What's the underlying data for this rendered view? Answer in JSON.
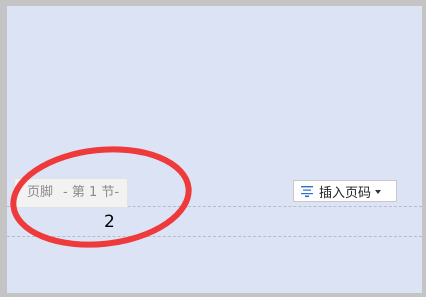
{
  "footer": {
    "label": "页脚",
    "section": "- 第 1 节-",
    "page_number": "2"
  },
  "insert_page_number": {
    "label": "插入页码",
    "icon": "page-number-icon",
    "dropdown_icon": "dropdown-arrow-icon"
  },
  "annotation": {
    "shape": "ellipse",
    "color": "#ee3a3a"
  }
}
